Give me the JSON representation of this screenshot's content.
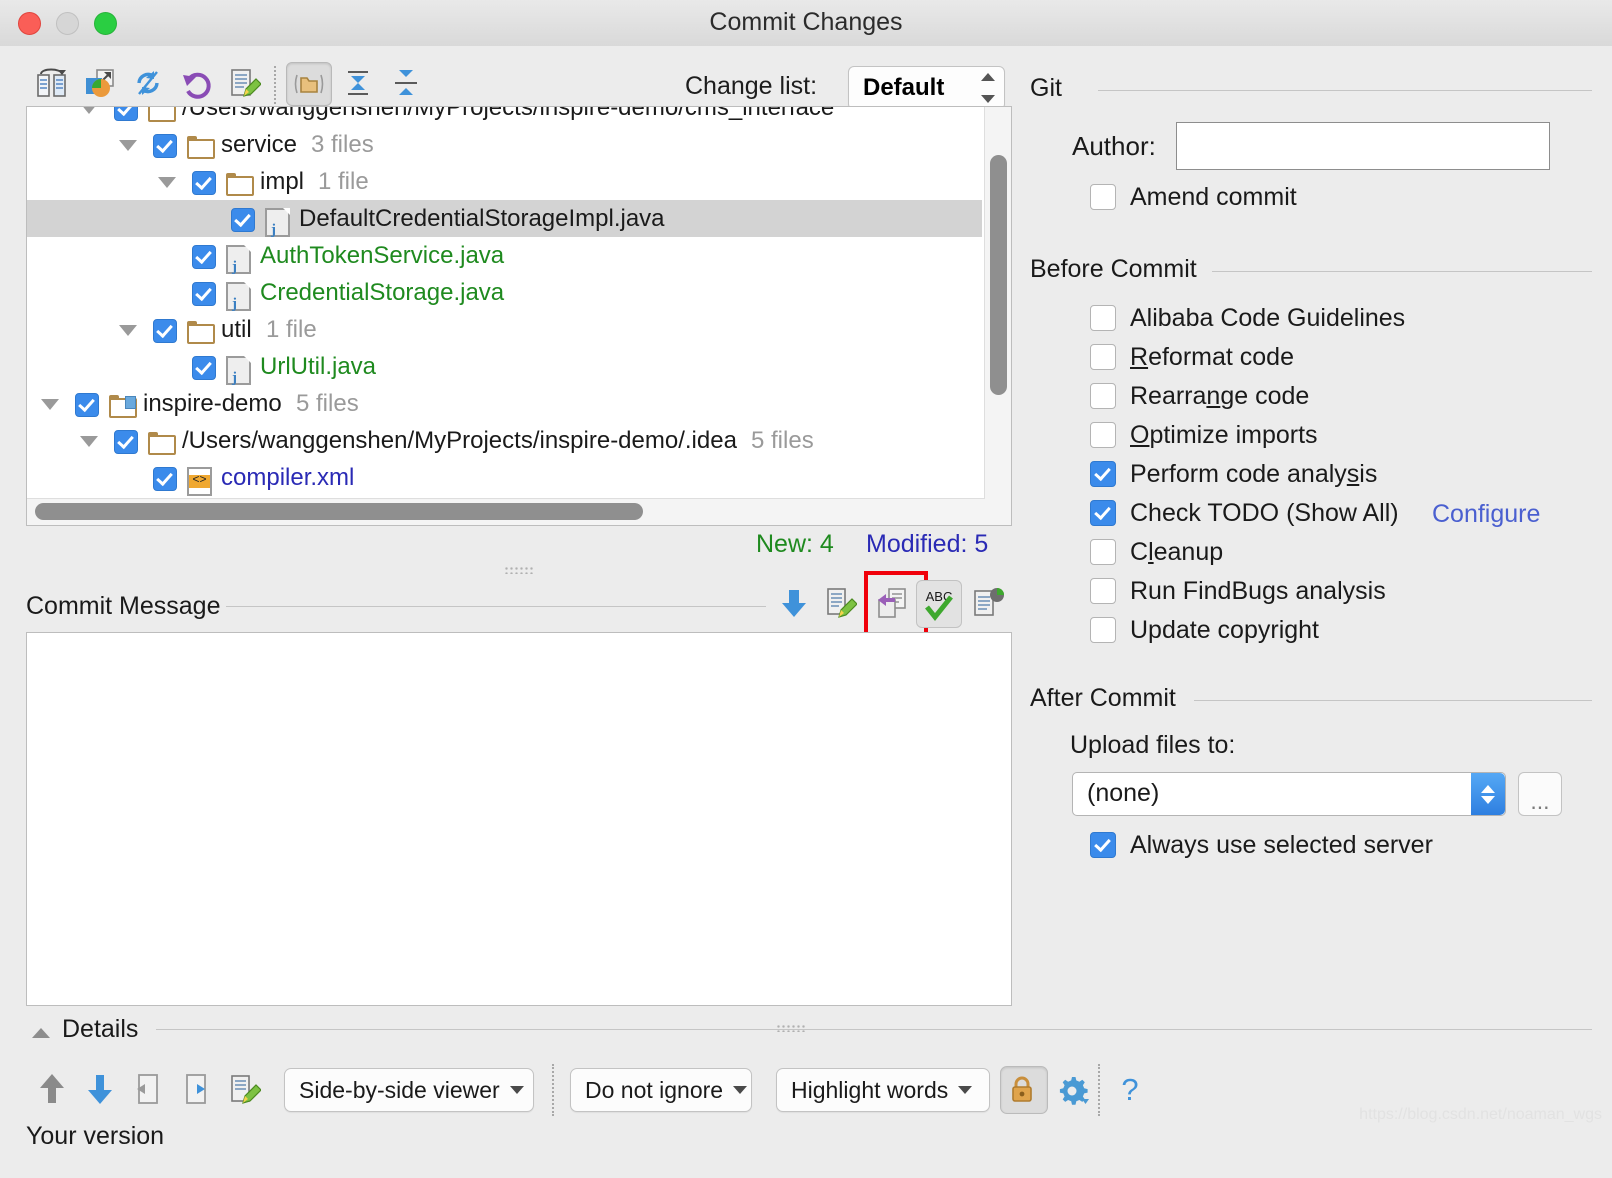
{
  "window": {
    "title": "Commit Changes",
    "traffic_lights": [
      "close",
      "minimize",
      "zoom"
    ]
  },
  "toolbar": {
    "icons": [
      {
        "name": "show-diff-icon",
        "label": "Show Diff"
      },
      {
        "name": "revert-move-icon",
        "label": "Move to Another Changelist"
      },
      {
        "name": "refresh-icon",
        "label": "Refresh Changes"
      },
      {
        "name": "rollback-icon",
        "label": "Rollback"
      },
      {
        "name": "edit-source-icon",
        "label": "Edit Source"
      },
      {
        "name": "group-by-directory-icon",
        "label": "Group by Directory"
      },
      {
        "name": "expand-all-icon",
        "label": "Expand All"
      },
      {
        "name": "collapse-all-icon",
        "label": "Collapse All"
      }
    ],
    "changelist_label": "Change list:",
    "changelist_value": "Default"
  },
  "tree": {
    "rows": [
      {
        "indent": 1,
        "twisty": true,
        "checked": true,
        "icon": "folder",
        "name": "/Users/wanggenshen/MyProjects/inspire-demo/cms_interface",
        "count": "",
        "color": "dark",
        "selected": false,
        "clipped": true
      },
      {
        "indent": 2,
        "twisty": true,
        "checked": true,
        "icon": "folder",
        "name": "service",
        "count": "3 files",
        "color": "dark",
        "selected": false
      },
      {
        "indent": 3,
        "twisty": true,
        "checked": true,
        "icon": "folder",
        "name": "impl",
        "count": "1 file",
        "color": "dark",
        "selected": false
      },
      {
        "indent": 4,
        "twisty": false,
        "checked": true,
        "icon": "java",
        "name": "DefaultCredentialStorageImpl.java",
        "count": "",
        "color": "dark",
        "selected": true
      },
      {
        "indent": 3,
        "twisty": false,
        "checked": true,
        "icon": "java",
        "name": "AuthTokenService.java",
        "count": "",
        "color": "green",
        "selected": false
      },
      {
        "indent": 3,
        "twisty": false,
        "checked": true,
        "icon": "java",
        "name": "CredentialStorage.java",
        "count": "",
        "color": "green",
        "selected": false
      },
      {
        "indent": 2,
        "twisty": true,
        "checked": true,
        "icon": "folder",
        "name": "util",
        "count": "1 file",
        "color": "dark",
        "selected": false
      },
      {
        "indent": 3,
        "twisty": false,
        "checked": true,
        "icon": "java",
        "name": "UrlUtil.java",
        "count": "",
        "color": "green",
        "selected": false
      },
      {
        "indent": 0,
        "twisty": true,
        "checked": true,
        "icon": "module",
        "name": "inspire-demo",
        "count": "5 files",
        "color": "dark",
        "selected": false
      },
      {
        "indent": 1,
        "twisty": true,
        "checked": true,
        "icon": "folder",
        "name": "/Users/wanggenshen/MyProjects/inspire-demo/.idea",
        "count": "5 files",
        "color": "dark",
        "selected": false
      },
      {
        "indent": 2,
        "twisty": false,
        "checked": true,
        "icon": "xml",
        "name": "compiler.xml",
        "count": "",
        "color": "blue",
        "selected": false
      }
    ]
  },
  "status": {
    "new_label": "New: 4",
    "modified_label": "Modified: 5"
  },
  "commit_message": {
    "label": "Commit Message",
    "value": "",
    "toolbar_icons": [
      {
        "name": "insert-down-arrow-icon",
        "label": "Commit Message History"
      },
      {
        "name": "edit-message-icon",
        "label": "Edit Message"
      },
      {
        "name": "paste-from-changes-icon",
        "label": "Insert Changed Files",
        "highlighted": true
      },
      {
        "name": "spellcheck-abc-icon",
        "label": "Spelling Check",
        "pressed": true
      },
      {
        "name": "clipboard-icon",
        "label": "Clipboard"
      }
    ]
  },
  "details": {
    "label": "Details"
  },
  "bottom_toolbar": {
    "icons": [
      {
        "name": "previous-difference-icon",
        "label": "Previous Difference"
      },
      {
        "name": "next-difference-icon",
        "label": "Next Difference"
      },
      {
        "name": "accept-left-icon",
        "label": "Accept Left Side"
      },
      {
        "name": "accept-right-icon",
        "label": "Accept Right Side"
      },
      {
        "name": "edit-source-icon",
        "label": "Edit Source"
      }
    ],
    "viewer_mode": "Side-by-side viewer",
    "ignore_mode": "Do not ignore",
    "highlight_mode": "Highlight words",
    "lock_icon": "lock-icon",
    "settings_icon": "gear-icon",
    "help_icon": "help-icon",
    "your_version_label": "Your version"
  },
  "right_panel": {
    "git": {
      "group_label": "Git",
      "author_label": "Author:",
      "author_value": "",
      "amend_label": "Amend commit",
      "amend_checked": false
    },
    "before_commit": {
      "group_label": "Before Commit",
      "items": [
        {
          "label": "Alibaba Code Guidelines",
          "checked": false,
          "mnemonic": ""
        },
        {
          "label": "Reformat code",
          "checked": false,
          "mnemonic": "R"
        },
        {
          "label": "Rearrange code",
          "checked": false,
          "mnemonic": "n"
        },
        {
          "label": "Optimize imports",
          "checked": false,
          "mnemonic": "O"
        },
        {
          "label": "Perform code analysis",
          "checked": true,
          "mnemonic": "s"
        },
        {
          "label": "Check TODO (Show All)",
          "checked": true,
          "mnemonic": ""
        },
        {
          "label": "Cleanup",
          "checked": false,
          "mnemonic": "l"
        },
        {
          "label": "Run FindBugs analysis",
          "checked": false,
          "mnemonic": ""
        },
        {
          "label": "Update copyright",
          "checked": false,
          "mnemonic": ""
        }
      ],
      "configure_link": "Configure"
    },
    "after_commit": {
      "group_label": "After Commit",
      "upload_label": "Upload files to:",
      "upload_value": "(none)",
      "browse_label": "...",
      "always_use_label": "Always use selected server",
      "always_use_checked": true
    }
  },
  "colors": {
    "accent_blue": "#3b8beb",
    "new_green": "#1f8a1f",
    "modified_blue": "#2a2ab5",
    "link_blue": "#4a5fd0",
    "highlight_red": "#f0000a",
    "selection_gray": "#d3d3d3"
  },
  "watermark": "https://blog.csdn.net/noaman_wgs"
}
